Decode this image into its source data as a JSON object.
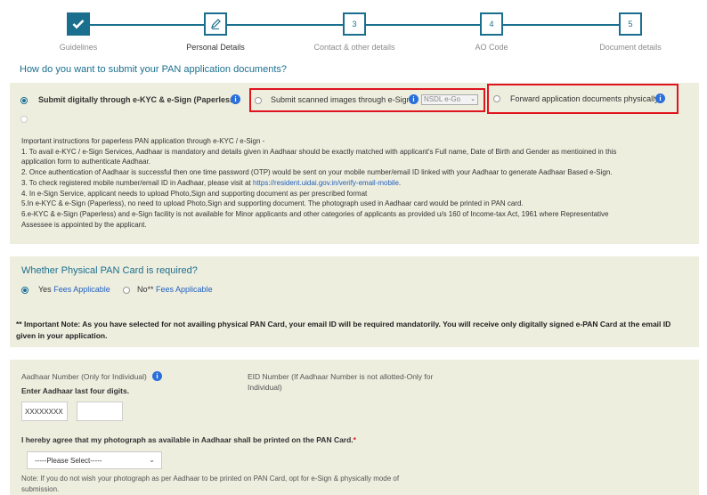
{
  "stepper": {
    "steps": [
      {
        "number": "",
        "label": "Guidelines",
        "icon": "check-icon"
      },
      {
        "number": "",
        "label": "Personal Details",
        "icon": "pencil-icon"
      },
      {
        "number": "3",
        "label": "Contact & other details"
      },
      {
        "number": "4",
        "label": "AO Code"
      },
      {
        "number": "5",
        "label": "Document details"
      }
    ],
    "active_step": "Personal Details"
  },
  "submission": {
    "question": "How do you want to submit your PAN application documents?",
    "option_ekyc": "Submit digitally through e-KYC & e-Sign (Paperless)",
    "option_scanned": "Submit scanned images through e-Sign",
    "scanned_select_value": "NSDL e-Go",
    "option_physical": "Forward application documents physically",
    "selected": "option_ekyc",
    "highlight_color": "#e0141e"
  },
  "instructions": {
    "heading": "Important instructions for paperless PAN application through e-KYC / e-Sign -",
    "line1a": "1. To avail e-KYC / e-Sign Services, Aadhaar is mandatory and details given in Aadhaar should be exactly matched with applicant's Full name, Date of Birth and Gender as mentioined in this",
    "line1b": "application form to authenticate Aadhaar.",
    "line2": "2. Once authentication of Aadhaar is successful then one time password (OTP) would be sent on your mobile number/email ID linked with your Aadhaar to generate Aadhaar Based e-Sign.",
    "line3_prefix": "3. To check registered mobile number/email ID in Aadhaar, please visit at ",
    "line3_link": "https://resident.uidai.gov.in/verify-email-mobile",
    "line3_suffix": ".",
    "line4": "4. In e-Sign Service, applicant needs to upload Photo,Sign and supporting document as per prescribed format",
    "line5": "5.In e-KYC & e-Sign (Paperless), no need to upload Photo,Sign and supporting document. The photograph used in Aadhaar card would be printed in PAN card.",
    "line6a": "6.e-KYC & e-Sign (Paperless) and e-Sign facility is not available for Minor applicants and other categories of applicants as provided u/s 160 of Income-tax Act, 1961 where Representative",
    "line6b": "Assessee is appointed by the applicant."
  },
  "physical_card": {
    "question": "Whether Physical PAN Card is required?",
    "yes_label": "Yes",
    "yes_link": "Fees Applicable",
    "no_label": "No**",
    "no_link": "Fees Applicable",
    "selected": "yes"
  },
  "important_note": {
    "line1": "** Important Note: As you have selected for not availing physical PAN Card, your email ID will be required mandatorily. You will receive only digitally signed e-PAN Card at the email ID",
    "line2": "given in your application."
  },
  "aadhaar": {
    "number_label": "Aadhaar Number (Only for Individual)",
    "last_four_label": "Enter Aadhaar last four digits.",
    "masked_value": "XXXXXXXX",
    "last_four_value": "",
    "eid_label_1": "EID Number (If Aadhaar Number is not allotted-Only for",
    "eid_label_2": "Individual)",
    "photo_agree_label": "I hereby agree that my photograph as available in Aadhaar shall be printed on the PAN Card.",
    "required_mark": "*",
    "photo_select_value": "-----Please Select-----",
    "note_1": "Note: If you do not wish your photograph as per Aadhaar to be printed on PAN Card, opt for e-Sign & physically mode of",
    "note_2": "submission."
  }
}
